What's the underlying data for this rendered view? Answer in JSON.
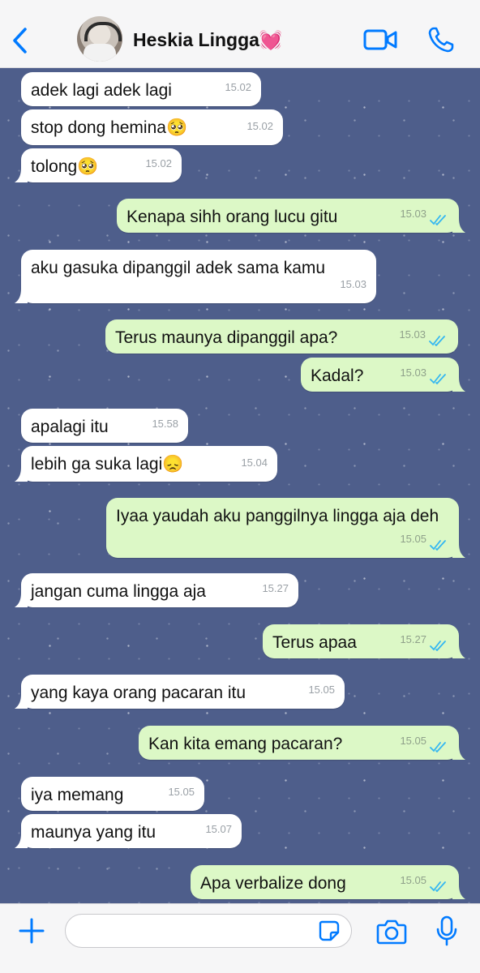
{
  "header": {
    "contact_name": "Heskia Lingga💓"
  },
  "messages": [
    {
      "dir": "in",
      "text": "adek lagi adek lagi",
      "time": "15.02"
    },
    {
      "dir": "in",
      "text": "stop dong hemina🥺",
      "time": "15.02"
    },
    {
      "dir": "in",
      "text": "tolong🥺",
      "time": "15.02"
    },
    {
      "dir": "out",
      "text": "Kenapa sihh orang lucu gitu",
      "time": "15.03",
      "status": "read"
    },
    {
      "dir": "in",
      "text": "aku gasuka dipanggil adek sama kamu",
      "time": "15.03"
    },
    {
      "dir": "out",
      "text": "Terus maunya dipanggil apa?",
      "time": "15.03",
      "status": "read"
    },
    {
      "dir": "out",
      "text": "Kadal?",
      "time": "15.03",
      "status": "read"
    },
    {
      "dir": "in",
      "text": "apalagi itu",
      "time": "15.58"
    },
    {
      "dir": "in",
      "text": "lebih ga suka lagi😞",
      "time": "15.04"
    },
    {
      "dir": "out",
      "text": "Iyaa yaudah aku panggilnya lingga aja deh",
      "time": "15.05",
      "status": "read"
    },
    {
      "dir": "in",
      "text": "jangan cuma lingga aja",
      "time": "15.27"
    },
    {
      "dir": "out",
      "text": "Terus apaa",
      "time": "15.27",
      "status": "read"
    },
    {
      "dir": "in",
      "text": "yang kaya orang pacaran itu",
      "time": "15.05"
    },
    {
      "dir": "out",
      "text": "Kan kita emang pacaran?",
      "time": "15.05",
      "status": "read"
    },
    {
      "dir": "in",
      "text": "iya memang",
      "time": "15.05"
    },
    {
      "dir": "in",
      "text": "maunya yang itu",
      "time": "15.07"
    },
    {
      "dir": "out",
      "text": "Apa verbalize dong",
      "time": "15.05",
      "status": "read"
    }
  ],
  "composer": {
    "value": "",
    "placeholder": ""
  },
  "colors": {
    "accent": "#007aff",
    "outgoing_bubble": "#dcf8c6",
    "incoming_bubble": "#ffffff",
    "wallpaper": "#4e5e8b",
    "read_ticks": "#34b7f1"
  },
  "icons": {
    "back": "chevron-left-icon",
    "video": "video-camera-icon",
    "call": "phone-icon",
    "attach": "plus-icon",
    "sticker": "sticker-icon",
    "camera": "camera-icon",
    "mic": "microphone-icon"
  }
}
